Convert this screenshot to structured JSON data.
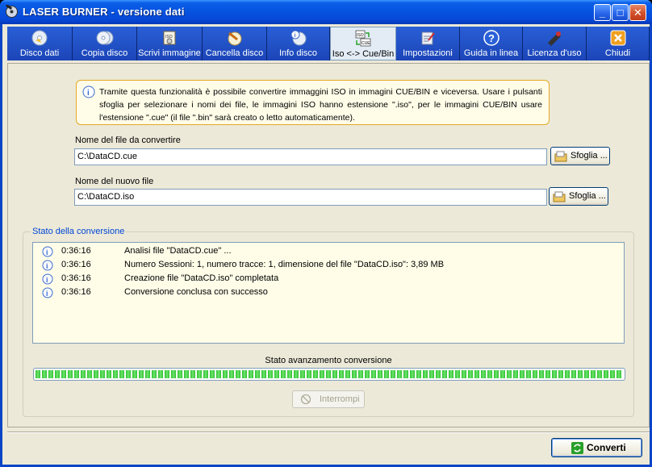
{
  "window": {
    "title": "LASER BURNER - versione dati",
    "minimize": "_",
    "maximize": "□",
    "close": "✕"
  },
  "toolbar": [
    {
      "label": "Disco dati",
      "icon": "disc-data-icon"
    },
    {
      "label": "Copia disco",
      "icon": "disc-copy-icon"
    },
    {
      "label": "Scrivi immagine",
      "icon": "write-image-icon"
    },
    {
      "label": "Cancella disco",
      "icon": "erase-disc-icon"
    },
    {
      "label": "Info disco",
      "icon": "disc-info-icon"
    },
    {
      "label": "Iso <-> Cue/Bin",
      "icon": "iso-cue-icon",
      "active": true
    },
    {
      "label": "Impostazioni",
      "icon": "settings-icon"
    },
    {
      "label": "Guida in linea",
      "icon": "help-icon"
    },
    {
      "label": "Licenza d'uso",
      "icon": "license-icon"
    },
    {
      "label": "Chiudi",
      "icon": "close-app-icon"
    }
  ],
  "info": {
    "text": "Tramite questa funzionalità è possibile convertire immaggini ISO in immagini CUE/BIN e viceversa. Usare i pulsanti sfoglia per selezionare i nomi dei file, le immagini ISO hanno estensione \".iso\", per le immagini CUE/BIN usare l'estensione \".cue\" (il file \".bin\" sarà creato o letto automaticamente)."
  },
  "source": {
    "label": "Nome del file da convertire",
    "value": "C:\\DataCD.cue",
    "browse": "Sfoglia ..."
  },
  "target": {
    "label": "Nome del nuovo file",
    "value": "C:\\DataCD.iso",
    "browse": "Sfoglia ..."
  },
  "status": {
    "title": "Stato della conversione",
    "log": [
      {
        "time": "0:36:16",
        "message": "Analisi file \"DataCD.cue\" ..."
      },
      {
        "time": "0:36:16",
        "message": "Numero Sessioni: 1, numero tracce: 1, dimensione del file \"DataCD.iso\": 3,89 MB"
      },
      {
        "time": "0:36:16",
        "message": "Creazione file \"DataCD.iso\" completata"
      },
      {
        "time": "0:36:16",
        "message": "Conversione conclusa con successo"
      }
    ],
    "progress_label": "Stato avanzamento conversione",
    "progress": 1.0,
    "stop_button": "Interrompi"
  },
  "actions": {
    "convert": "Converti"
  },
  "colors": {
    "accent": "#0a5ee8",
    "progress": "#2fbf2f",
    "info_bg": "#fffde8",
    "group_title": "#0046d5"
  }
}
